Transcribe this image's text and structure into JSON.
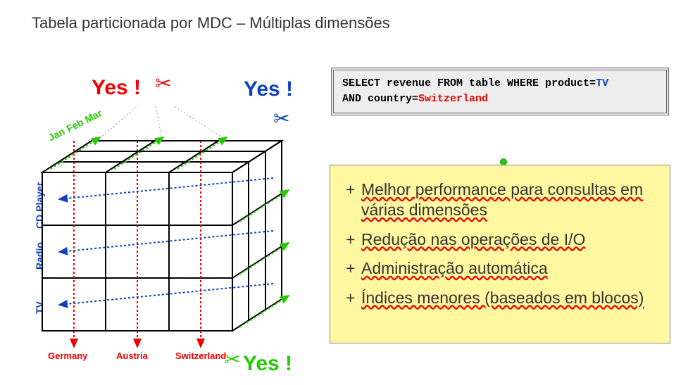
{
  "title": "Tabela particionada por MDC – Múltiplas dimensões",
  "yes": {
    "red": "Yes !",
    "blue": "Yes !",
    "green": "Yes !"
  },
  "scissors_glyph": "✂",
  "axes": {
    "months": [
      "Jan",
      "Feb",
      "Mar"
    ],
    "products": [
      "CD Player",
      "Radio",
      "TV"
    ],
    "countries": [
      "Germany",
      "Austria",
      "Switzerland"
    ]
  },
  "sql": {
    "p1": "SELECT revenue FROM table WHERE product=",
    "val1": "TV",
    "p2": "AND country=",
    "val2": "Switzerland"
  },
  "bullets": [
    "Melhor performance para consultas em várias dimensões",
    "Redução nas operações de I/O",
    "Administração automática",
    "Índices menores (baseados em blocos)"
  ]
}
